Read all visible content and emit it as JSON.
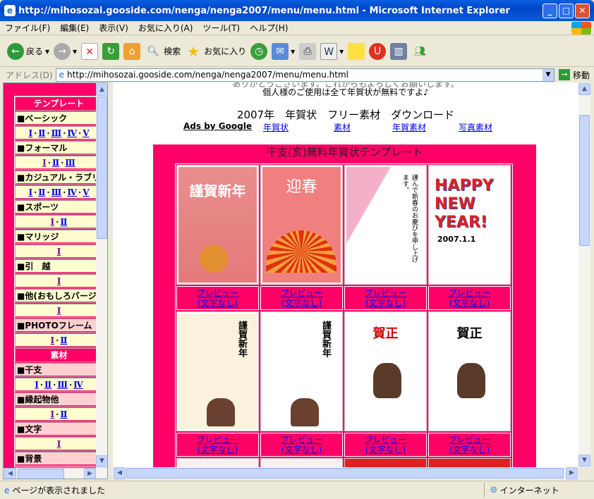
{
  "window": {
    "title": "http://mihosozai.gooside.com/nenga/nenga2007/menu/menu.html - Microsoft Internet Explorer"
  },
  "menubar": [
    "ファイル(F)",
    "編集(E)",
    "表示(V)",
    "お気に入り(A)",
    "ツール(T)",
    "ヘルプ(H)"
  ],
  "toolbar": {
    "back": "戻る",
    "search": "検索",
    "favorites": "お気に入り"
  },
  "address": {
    "label": "アドレス(D)",
    "url": "http://mihosozai.gooside.com/nenga/nenga2007/menu/menu.html",
    "go": "移動"
  },
  "status": {
    "text": "ページが表示されました",
    "zone": "インターネット"
  },
  "sidebar": {
    "template_header": "テンプレート",
    "material_header": "素材",
    "categories": [
      {
        "name": "■ベーシック",
        "links": [
          "Ⅰ",
          "Ⅱ",
          "Ⅲ",
          "Ⅳ",
          "Ⅴ"
        ]
      },
      {
        "name": "■フォーマル",
        "links": [
          "Ⅰ",
          "Ⅱ",
          "Ⅲ"
        ]
      },
      {
        "name": "■カジュアル・ラブリー",
        "links": [
          "Ⅰ",
          "Ⅱ",
          "Ⅲ",
          "Ⅳ",
          "Ⅴ"
        ]
      },
      {
        "name": "■スポーツ",
        "links": [
          "Ⅰ",
          "Ⅱ"
        ]
      },
      {
        "name": "■マリッジ",
        "links": [
          "Ⅰ"
        ]
      },
      {
        "name": "■引　越",
        "links": [
          "Ⅰ"
        ]
      },
      {
        "name": "■他(おもしろバージョン)",
        "links": [
          "Ⅰ"
        ]
      },
      {
        "name": "■PHOTOフレーム",
        "links": [
          "Ⅰ",
          "Ⅱ"
        ]
      }
    ],
    "materials": [
      {
        "name": "■干支",
        "links": [
          "Ⅰ",
          "Ⅱ",
          "Ⅲ",
          "Ⅳ"
        ]
      },
      {
        "name": "■縁起物他",
        "links": [
          "Ⅰ",
          "Ⅱ"
        ]
      },
      {
        "name": "■文字",
        "links": [
          "Ⅰ"
        ]
      },
      {
        "name": "■背景",
        "links": []
      }
    ]
  },
  "main": {
    "intro_cut": "ありがとうございます。これからもよろしくお願いします。",
    "intro": "個人様のご使用は全て年賀状が無料ですよ♪",
    "heading": "2007年　年賀状　フリー素材　ダウンロード",
    "ads": {
      "label": "Ads by Google",
      "links": [
        "年賀状",
        "素材",
        "年賀素材",
        "写真素材"
      ]
    },
    "table_title": "干支(亥)無料年賀状テンプレート",
    "preview": "プレビュー",
    "no_text": "(文字なし)",
    "cards": [
      {
        "text": "謹賀新年",
        "bg": "#e88a8a"
      },
      {
        "text": "迎春",
        "bg": "#f07f7f"
      },
      {
        "text": "謹んで新春のお慶びを申し上げます。",
        "bg": "#fbe6ee"
      },
      {
        "text": "HAPPY NEW YEAR!",
        "sub": "2007.1.1",
        "bg": "#ffffff"
      },
      {
        "text": "謹賀新年",
        "bg": "#fbf1dc"
      },
      {
        "text": "謹賀新年",
        "bg": "#ffffff"
      },
      {
        "text": "賀正",
        "bg": "#ffffff"
      },
      {
        "text": "賀正",
        "bg": "#ffffff"
      }
    ]
  }
}
